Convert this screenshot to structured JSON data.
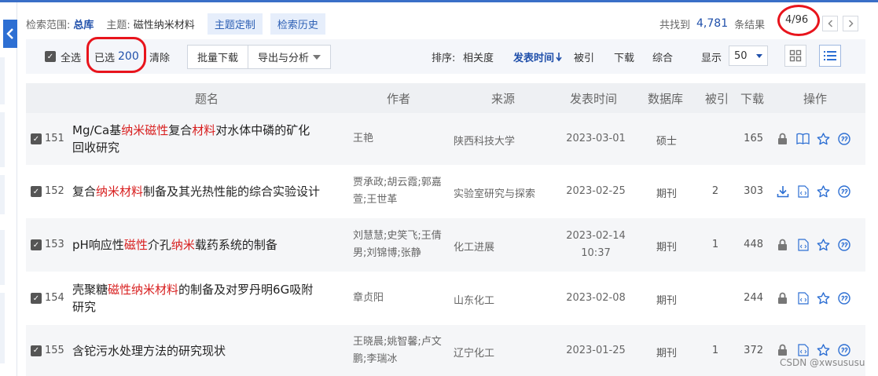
{
  "scope": {
    "label": "检索范围:",
    "value": "总库",
    "theme_label": "主题:",
    "theme_value": "磁性纳米材料",
    "custom_theme": "主题定制",
    "history": "检索历史"
  },
  "results": {
    "found_label": "共找到",
    "count": "4,781",
    "suffix": "条结果",
    "page": "4/96",
    "prev_icon": "chevron-left",
    "next_icon": "chevron-right"
  },
  "toolbar": {
    "select_all": "全选",
    "selected_label": "已选",
    "selected_count": "200",
    "clear": "清除",
    "batch_download": "批量下载",
    "export_analysis": "导出与分析",
    "sort_label": "排序:",
    "sort_relevance": "相关度",
    "sort_date": "发表时间",
    "sort_cited": "被引",
    "sort_download": "下载",
    "sort_overall": "综合",
    "show_label": "显示",
    "show_value": "50"
  },
  "table": {
    "headers": {
      "title": "题名",
      "author": "作者",
      "source": "来源",
      "date": "发表时间",
      "database": "数据库",
      "cited": "被引",
      "download": "下载",
      "ops": "操作"
    },
    "rows": [
      {
        "index": "151",
        "title_parts": [
          [
            "Mg/Ca基",
            false
          ],
          [
            "纳米磁性",
            true
          ],
          [
            "复合",
            false
          ],
          [
            "材料",
            true
          ],
          [
            "对水体中磷的矿化",
            false
          ]
        ],
        "title_line2": "回收研究",
        "author_l1": "王艳",
        "author_l2": "",
        "source": "陕西科技大学",
        "date_l1": "2023-03-01",
        "date_l2": "",
        "database": "硕士",
        "cited": "",
        "download": "165",
        "ops": [
          "lock-icon",
          "book-icon",
          "star-icon",
          "quote-icon"
        ]
      },
      {
        "index": "152",
        "title_parts": [
          [
            "复合",
            false
          ],
          [
            "纳米材料",
            true
          ],
          [
            "制备及其光热性能的综合实验设计",
            false
          ]
        ],
        "title_line2": "",
        "author_l1": "贾承政;胡云霞;郭嘉",
        "author_l2": "萱;王世革",
        "source": "实验室研究与探索",
        "date_l1": "2023-02-25",
        "date_l2": "",
        "database": "期刊",
        "cited": "2",
        "download": "303",
        "ops": [
          "download-icon",
          "html-icon",
          "star-icon",
          "quote-icon"
        ]
      },
      {
        "index": "153",
        "title_parts": [
          [
            "pH响应性",
            false
          ],
          [
            "磁性",
            true
          ],
          [
            "介孔",
            false
          ],
          [
            "纳米",
            true
          ],
          [
            "载药系统的制备",
            false
          ]
        ],
        "title_line2": "",
        "author_l1": "刘慧慧;史笑飞;王倩",
        "author_l2": "男;刘锦博;张静",
        "source": "化工进展",
        "date_l1": "2023-02-14",
        "date_l2": "10:37",
        "database": "期刊",
        "cited": "1",
        "download": "448",
        "ops": [
          "lock-icon",
          "html-icon",
          "star-icon",
          "quote-icon"
        ]
      },
      {
        "index": "154",
        "title_parts": [
          [
            "壳聚糖",
            false
          ],
          [
            "磁性纳米材料",
            true
          ],
          [
            "的制备及对罗丹明6G吸附",
            false
          ]
        ],
        "title_line2": "研究",
        "author_l1": "章贞阳",
        "author_l2": "",
        "source": "山东化工",
        "date_l1": "2023-02-08",
        "date_l2": "",
        "database": "期刊",
        "cited": "",
        "download": "244",
        "ops": [
          "lock-icon",
          "html-icon",
          "star-icon",
          "quote-icon"
        ]
      },
      {
        "index": "155",
        "title_parts": [
          [
            "含铊污水处理方法的研究现状",
            false
          ]
        ],
        "title_line2": "",
        "author_l1": "王晓晨;姚智馨;卢文",
        "author_l2": "鹏;李瑞冰",
        "source": "辽宁化工",
        "date_l1": "2023-01-25",
        "date_l2": "",
        "database": "期刊",
        "cited": "1",
        "download": "372",
        "ops": [
          "lock-icon",
          "html-icon",
          "star-icon",
          "quote-icon"
        ]
      }
    ]
  },
  "watermark": "CSDN @xwsususu",
  "colors": {
    "accent": "#1f4faa",
    "highlight": "#d81e1e",
    "annotation": "#e8141c",
    "op_icon": "#2d6fd3"
  }
}
